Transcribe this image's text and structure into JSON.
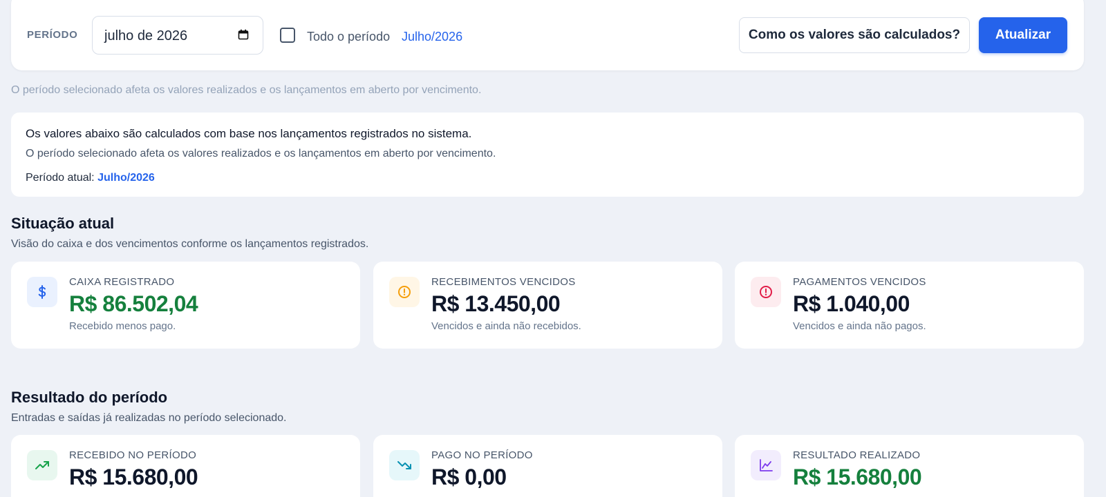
{
  "filter": {
    "periodo_label": "PERÍODO",
    "date_value": "julho de 2026",
    "todo_label": "Todo o período",
    "period_badge": "Julho/2026",
    "como_button": "Como os valores são calculados?",
    "atualizar_button": "Atualizar"
  },
  "hint": "O período selecionado afeta os valores realizados e os lançamentos em aberto por vencimento.",
  "info": {
    "line1": "Os valores abaixo são calculados com base nos lançamentos registrados no sistema.",
    "line2": "O período selecionado afeta os valores realizados e os lançamentos em aberto por vencimento.",
    "periodo_label": "Período atual:",
    "periodo_value": "Julho/2026"
  },
  "situacao": {
    "title": "Situação atual",
    "subtitle": "Visão do caixa e dos vencimentos conforme os lançamentos registrados.",
    "cards": [
      {
        "icon": "dollar-icon",
        "label": "CAIXA REGISTRADO",
        "value": "R$ 86.502,04",
        "desc": "Recebido menos pago."
      },
      {
        "icon": "alert-circle-icon",
        "label": "RECEBIMENTOS VENCIDOS",
        "value": "R$ 13.450,00",
        "desc": "Vencidos e ainda não recebidos."
      },
      {
        "icon": "alert-circle-icon",
        "label": "PAGAMENTOS VENCIDOS",
        "value": "R$ 1.040,00",
        "desc": "Vencidos e ainda não pagos."
      }
    ]
  },
  "resultado": {
    "title": "Resultado do período",
    "subtitle": "Entradas e saídas já realizadas no período selecionado.",
    "cards": [
      {
        "icon": "trending-up-icon",
        "label": "RECEBIDO NO PERÍODO",
        "value": "R$ 15.680,00"
      },
      {
        "icon": "trending-down-icon",
        "label": "PAGO NO PERÍODO",
        "value": "R$ 0,00"
      },
      {
        "icon": "line-chart-icon",
        "label": "RESULTADO REALIZADO",
        "value": "R$ 15.680,00"
      }
    ]
  },
  "colors": {
    "primary": "#2563eb",
    "positive": "#15803d",
    "warning": "#f59e0b",
    "danger": "#e11d48",
    "teal": "#0891b2",
    "purple": "#7c3aed"
  }
}
